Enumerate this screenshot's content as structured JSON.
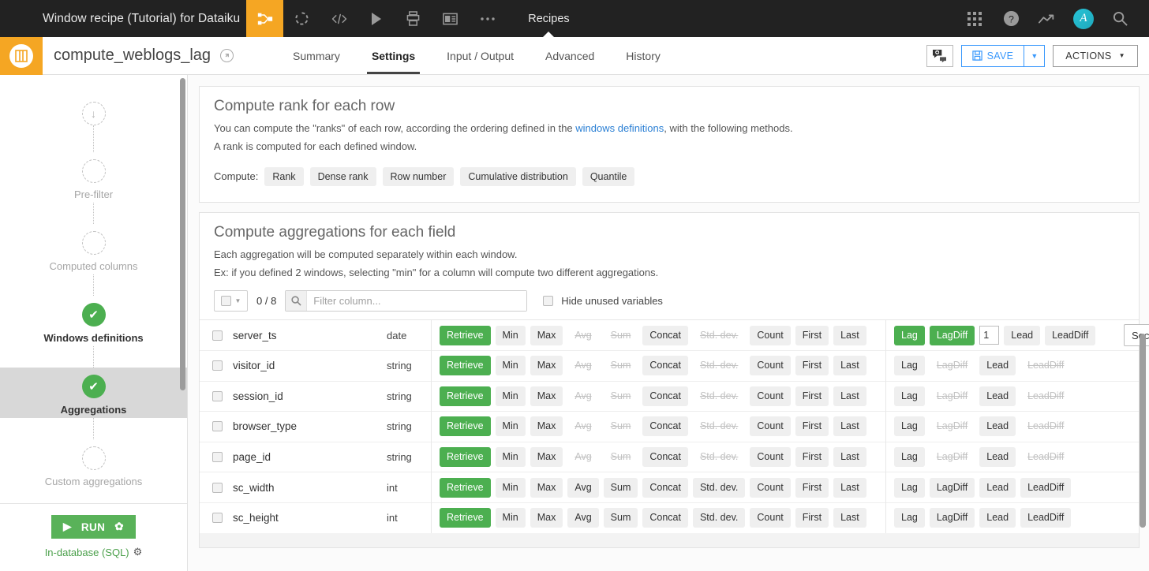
{
  "topbar": {
    "title": "Window recipe (Tutorial) for Dataiku",
    "nav_label": "Recipes",
    "icons": [
      "recipe-flow-icon",
      "dataset-circle-icon",
      "code-icon",
      "play-icon",
      "notebook-icon",
      "dashboard-icon",
      "more-dots-icon"
    ],
    "right_icons": [
      "apps-grid-icon",
      "help-icon",
      "trending-icon",
      "avatar",
      "search-icon"
    ],
    "avatar_initial": "A",
    "accent_color": "#f5a623",
    "bg_color": "#222222"
  },
  "subbar": {
    "recipe_name": "compute_weblogs_lag",
    "tabs": [
      {
        "label": "Summary",
        "selected": false
      },
      {
        "label": "Settings",
        "selected": true
      },
      {
        "label": "Input / Output",
        "selected": false
      },
      {
        "label": "Advanced",
        "selected": false
      },
      {
        "label": "History",
        "selected": false
      }
    ],
    "save_label": "SAVE",
    "actions_label": "ACTIONS",
    "save_color": "#3b99fc"
  },
  "sidebar": {
    "steps": [
      {
        "label": "",
        "state": "input",
        "icon": "arrow-down-icon"
      },
      {
        "label": "Pre-filter",
        "state": "empty"
      },
      {
        "label": "Computed columns",
        "state": "empty"
      },
      {
        "label": "Windows definitions",
        "state": "done"
      },
      {
        "label": "Aggregations",
        "state": "done",
        "selected": true
      },
      {
        "label": "Custom aggregations",
        "state": "empty"
      }
    ],
    "run_label": "RUN",
    "engine_label": "In-database (SQL)",
    "run_color": "#59b259"
  },
  "rank_section": {
    "title": "Compute rank for each row",
    "desc_prefix": "You can compute the \"ranks\" of each row, according the ordering defined in the ",
    "desc_link": "windows definitions",
    "desc_suffix": ", with the following methods.",
    "desc_line2": "A rank is computed for each defined window.",
    "compute_label": "Compute:",
    "options": [
      {
        "label": "Rank",
        "selected": false
      },
      {
        "label": "Dense rank",
        "selected": false
      },
      {
        "label": "Row number",
        "selected": false
      },
      {
        "label": "Cumulative distribution",
        "selected": false
      },
      {
        "label": "Quantile",
        "selected": false
      }
    ]
  },
  "agg_section": {
    "title": "Compute aggregations for each field",
    "desc_line1": "Each aggregation will be computed separately within each window.",
    "desc_line2": "Ex: if you defined 2 windows, selecting \"min\" for a column will compute two different aggregations.",
    "selected_count": "0 / 8",
    "filter_placeholder": "Filter column...",
    "filter_value": "",
    "hide_unused_label": "Hide unused variables",
    "hide_unused_checked": false,
    "select_all_checked": false,
    "group1_ops": [
      "Retrieve",
      "Min",
      "Max",
      "Avg",
      "Sum",
      "Concat",
      "Std. dev.",
      "Count",
      "First",
      "Last"
    ],
    "group2_ops": [
      "Lag",
      "LagDiff",
      "Lead",
      "LeadDiff"
    ],
    "rows": [
      {
        "name": "server_ts",
        "type": "date",
        "checked": false,
        "g1": [
          "on",
          "idle",
          "idle",
          "off",
          "off",
          "idle",
          "off",
          "idle",
          "idle",
          "idle"
        ],
        "g2": [
          "on",
          "on",
          "idle",
          "idle"
        ],
        "lag_value": "1",
        "unit": "Seconds",
        "has_unit": true
      },
      {
        "name": "visitor_id",
        "type": "string",
        "checked": false,
        "g1": [
          "on",
          "idle",
          "idle",
          "off",
          "off",
          "idle",
          "off",
          "idle",
          "idle",
          "idle"
        ],
        "g2": [
          "idle",
          "off",
          "idle",
          "off"
        ],
        "has_unit": false
      },
      {
        "name": "session_id",
        "type": "string",
        "checked": false,
        "g1": [
          "on",
          "idle",
          "idle",
          "off",
          "off",
          "idle",
          "off",
          "idle",
          "idle",
          "idle"
        ],
        "g2": [
          "idle",
          "off",
          "idle",
          "off"
        ],
        "has_unit": false
      },
      {
        "name": "browser_type",
        "type": "string",
        "checked": false,
        "g1": [
          "on",
          "idle",
          "idle",
          "off",
          "off",
          "idle",
          "off",
          "idle",
          "idle",
          "idle"
        ],
        "g2": [
          "idle",
          "off",
          "idle",
          "off"
        ],
        "has_unit": false
      },
      {
        "name": "page_id",
        "type": "string",
        "checked": false,
        "g1": [
          "on",
          "idle",
          "idle",
          "off",
          "off",
          "idle",
          "off",
          "idle",
          "idle",
          "idle"
        ],
        "g2": [
          "idle",
          "off",
          "idle",
          "off"
        ],
        "has_unit": false
      },
      {
        "name": "sc_width",
        "type": "int",
        "checked": false,
        "g1": [
          "on",
          "idle",
          "idle",
          "idle",
          "idle",
          "idle",
          "idle",
          "idle",
          "idle",
          "idle"
        ],
        "g2": [
          "idle",
          "idle",
          "idle",
          "idle"
        ],
        "has_unit": false
      },
      {
        "name": "sc_height",
        "type": "int",
        "checked": false,
        "g1": [
          "on",
          "idle",
          "idle",
          "idle",
          "idle",
          "idle",
          "idle",
          "idle",
          "idle",
          "idle"
        ],
        "g2": [
          "idle",
          "idle",
          "idle",
          "idle"
        ],
        "has_unit": false
      }
    ]
  }
}
